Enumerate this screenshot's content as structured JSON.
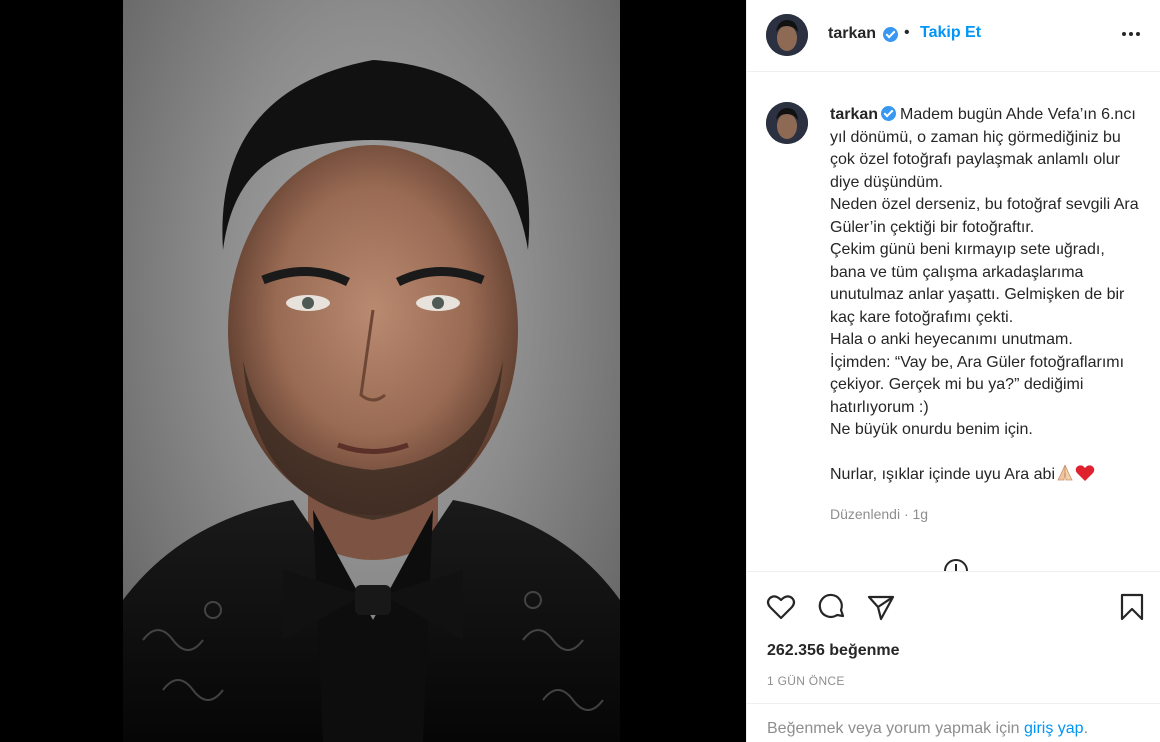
{
  "header": {
    "username": "tarkan",
    "separator": "•",
    "follow_label": "Takip Et"
  },
  "caption": {
    "username": "tarkan",
    "text_main": "Madem bugün Ahde Vefa’ın 6.ncı yıl dönümü, o zaman hiç görmediğiniz bu çok özel fotoğrafı paylaşmak anlamlı olur diye düşündüm.\nNeden özel derseniz, bu fotoğraf sevgili Ara Güler’in çektiği bir fotoğraftır.\nÇekim günü beni kırmayıp sete uğradı, bana ve tüm çalışma arkadaşlarıma unutulmaz anlar yaşattı. Gelmişken de bir kaç kare fotoğrafımı çekti.\nHala o anki heyecanımı unutmam.\nİçimden: “Vay be, Ara Güler fotoğraflarımı çekiyor. Gerçek mi bu ya?” dediğimi hatırlıyorum :)\nNe büyük onurdu benim için.\n\n",
    "text_last": "Nurlar, ışıklar içinde uyu Ara abi",
    "edited": "Düzenlendi · 1g"
  },
  "stats": {
    "likes": "262.356 beğenme",
    "time": "1 GÜN ÖNCE"
  },
  "footer": {
    "prefix": "Beğenmek veya yorum yapmak için ",
    "login": "giriş yap",
    "suffix": "."
  },
  "icons": [
    "more-options-icon",
    "verified-badge-icon",
    "heart-icon",
    "comment-icon",
    "share-icon",
    "bookmark-icon",
    "load-more-comments-icon"
  ],
  "colors": {
    "link_blue": "#0095f6",
    "verified_blue": "#3897f0",
    "text": "#262626",
    "muted": "#8e8e8e"
  }
}
